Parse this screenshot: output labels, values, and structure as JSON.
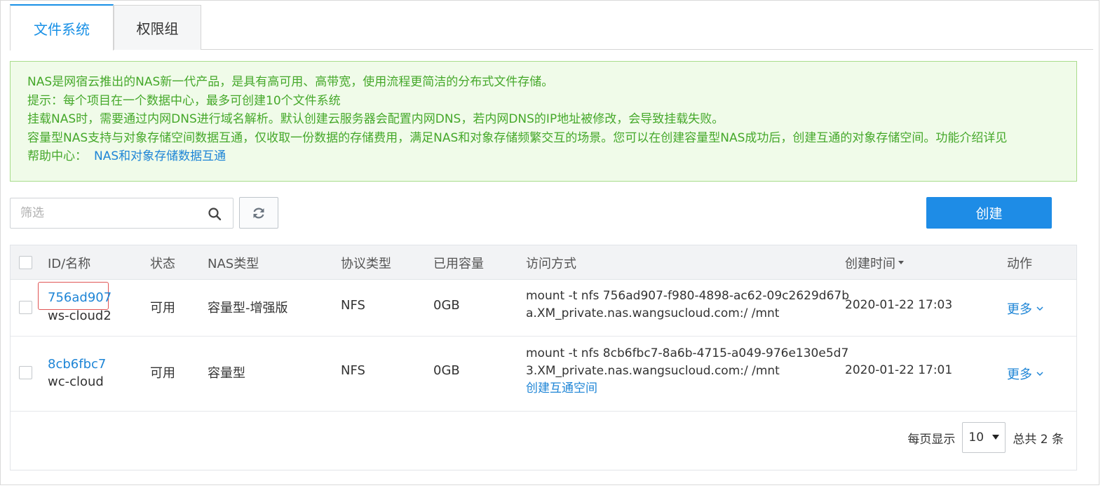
{
  "tabs": [
    {
      "label": "文件系统",
      "active": true
    },
    {
      "label": "权限组",
      "active": false
    }
  ],
  "notice": {
    "line1": "NAS是网宿云推出的NAS新一代产品，是具有高可用、高带宽，使用流程更简洁的分布式文件存储。",
    "line2": "提示：每个项目在一个数据中心，最多可创建10个文件系统",
    "line3": "挂载NAS时，需要通过内网DNS进行域名解析。默认创建云服务器会配置内网DNS，若内网DNS的IP地址被修改，会导致挂载失败。",
    "line4": "容量型NAS支持与对象存储空间数据互通，仅收取一份数据的存储费用，满足NAS和对象存储频繁交互的场景。您可以在创建容量型NAS成功后，创建互通的对象存储空间。功能介绍详见",
    "line5_prefix": "帮助中心：",
    "line5_link": "NAS和对象存储数据互通"
  },
  "toolbar": {
    "filter_placeholder": "筛选",
    "search_icon": "search-icon",
    "refresh_icon": "refresh-icon",
    "create_label": "创建"
  },
  "table": {
    "headers": {
      "id_name": "ID/名称",
      "status": "状态",
      "nas_type": "NAS类型",
      "protocol": "协议类型",
      "used": "已用容量",
      "access": "访问方式",
      "created": "创建时间",
      "action": "动作"
    },
    "rows": [
      {
        "id": "756ad907",
        "name": "ws-cloud2",
        "status": "可用",
        "nas_type": "容量型-增强版",
        "protocol": "NFS",
        "used": "0GB",
        "access_line1": "mount -t nfs 756ad907-f980-4898-ac62-09c2629d67b",
        "access_line2": "a.XM_private.nas.wangsucloud.com:/ /mnt",
        "created": "2020-01-22 17:03",
        "action": "更多"
      },
      {
        "id": "8cb6fbc7",
        "name": "wc-cloud",
        "status": "可用",
        "nas_type": "容量型",
        "protocol": "NFS",
        "used": "0GB",
        "access_line1": "mount -t nfs 8cb6fbc7-8a6b-4715-a049-976e130e5d7",
        "access_line2": "3.XM_private.nas.wangsucloud.com:/ /mnt",
        "access_link": "创建互通空间",
        "created": "2020-01-22 17:01",
        "action": "更多"
      }
    ]
  },
  "pagination": {
    "per_page_label": "每页显示",
    "per_page_value": "10",
    "total_label": "总共 2 条"
  },
  "colors": {
    "accent": "#1e8ce6",
    "notice_bg": "#f0fbe9",
    "notice_text": "#45a82a",
    "highlight_border": "#e05555"
  }
}
